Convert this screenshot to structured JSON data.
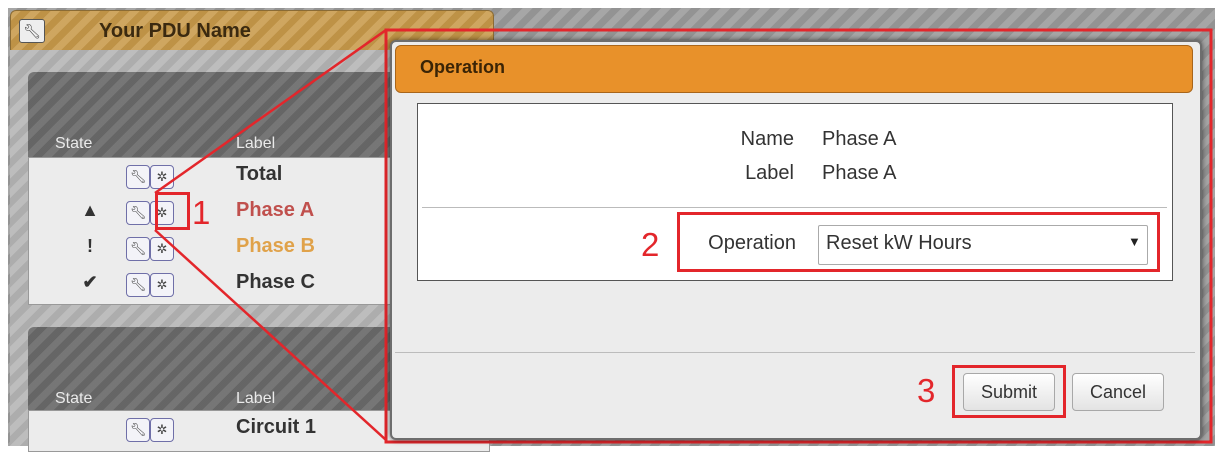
{
  "background": {
    "pdu_title": "Your PDU Name",
    "panel1": {
      "state_header": "State",
      "label_header": "Label",
      "rows": [
        {
          "state_icon": "",
          "label": "Total"
        },
        {
          "state_icon": "▲",
          "label": "Phase A"
        },
        {
          "state_icon": "!",
          "label": "Phase B"
        },
        {
          "state_icon": "✔",
          "label": "Phase C"
        }
      ]
    },
    "panel2": {
      "state_header": "State",
      "label_header": "Label",
      "rows": [
        {
          "state_icon": "",
          "label": "Circuit 1"
        }
      ]
    }
  },
  "annotations": {
    "step1": "1",
    "step2": "2",
    "step3": "3",
    "color": "#e3262b"
  },
  "dialog": {
    "title": "Operation",
    "name_key": "Name",
    "name_value": "Phase A",
    "label_key": "Label",
    "label_value": "Phase A",
    "operation_key": "Operation",
    "operation_selected": "Reset kW Hours",
    "submit_label": "Submit",
    "cancel_label": "Cancel",
    "accent_color": "#e8912a"
  },
  "icons": {
    "wrench": "wrench-icon",
    "gear": "gear-icon",
    "warning": "warning-icon",
    "exclamation": "exclamation-icon",
    "check": "check-icon"
  }
}
